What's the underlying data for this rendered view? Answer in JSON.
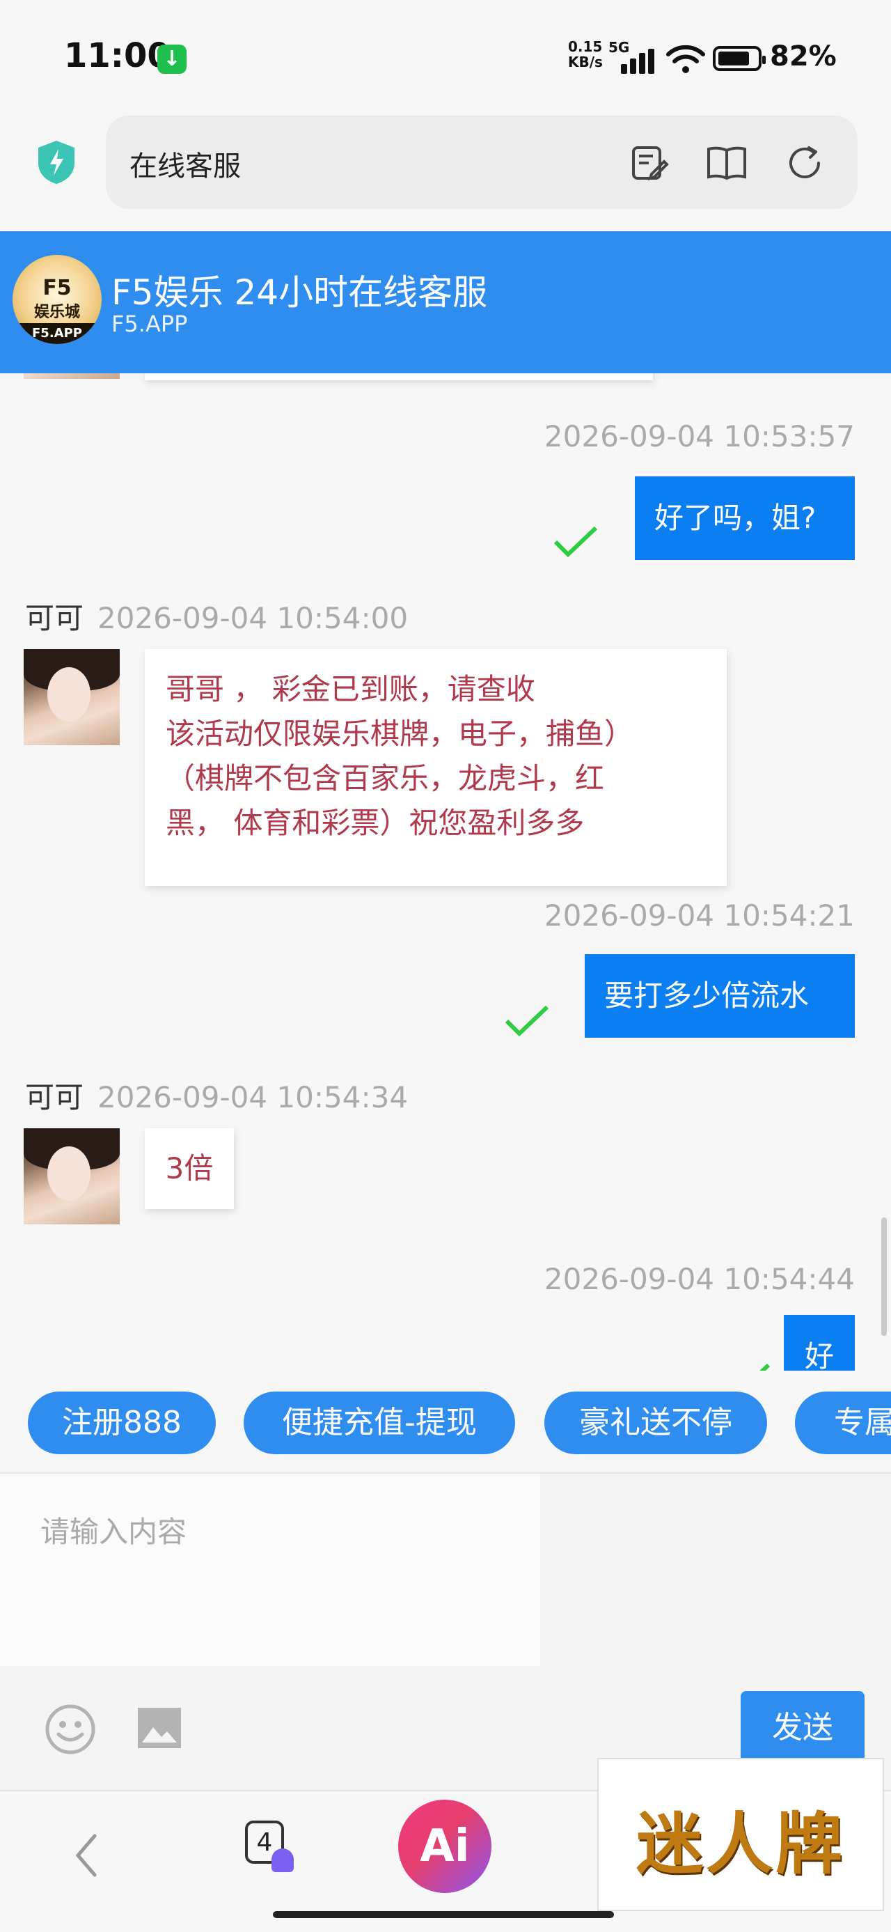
{
  "status_bar": {
    "time": "11:00",
    "net_speed_value": "0.15",
    "net_speed_unit": "KB/s",
    "network": "5G",
    "battery": "82%"
  },
  "browser": {
    "address_text": "在线客服"
  },
  "chat_header": {
    "logo_line1": "F5",
    "logo_line2": "娱乐城",
    "logo_line3": "F5.APP",
    "title": "F5娱乐 24小时在线客服",
    "subtitle": "F5.APP"
  },
  "messages": [
    {
      "side": "out",
      "time": "2026-09-04 10:53:57",
      "text": "好了吗，姐?"
    },
    {
      "side": "in",
      "sender": "可可",
      "time": "2026-09-04 10:54:00",
      "lines": [
        "哥哥 ， 彩金已到账，请查收",
        "该活动仅限娱乐棋牌，电子，捕鱼）",
        "（棋牌不包含百家乐，龙虎斗，红",
        "黑， 体育和彩票）祝您盈利多多"
      ]
    },
    {
      "side": "out",
      "time": "2026-09-04 10:54:21",
      "text": "要打多少倍流水"
    },
    {
      "side": "in",
      "sender": "可可",
      "time": "2026-09-04 10:54:34",
      "text": "3倍"
    },
    {
      "side": "out",
      "time": "2026-09-04 10:54:44",
      "text": "好"
    }
  ],
  "quick_replies": [
    "注册888",
    "便捷充值-提现",
    "豪礼送不停",
    "专属"
  ],
  "composer": {
    "placeholder": "请输入内容",
    "send_label": "发送"
  },
  "nav": {
    "tab_count": "4",
    "ai_label": "Ai",
    "ad_text": "迷人牌"
  },
  "colors": {
    "header_blue": "#2f8df0",
    "out_bubble": "#0b7ff2",
    "in_text": "#b03a4c",
    "check_green": "#2ecc40"
  }
}
